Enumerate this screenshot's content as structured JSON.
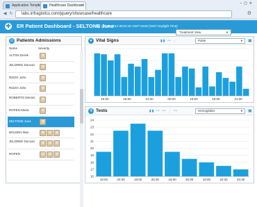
{
  "browser": {
    "tabs": [
      {
        "label": "Application Templat"
      },
      {
        "label": "Healthcare Dashboard"
      }
    ],
    "url": "labs.infragistics.com/jquery/showcase/healthcare"
  },
  "app": {
    "title": "ER Patient Dashboard - SELTONE June",
    "datetime": "Tue Oct 16 2012 08:01:01 GMT+0100 (GMT Daylight Time)",
    "view_dropdown": "Treatment View"
  },
  "patients": {
    "title": "Patients Admissions",
    "col_name": "Name",
    "col_severity": "Severity",
    "rows": [
      {
        "name": "ALTON Derek",
        "severity": 1
      },
      {
        "name": "JELDREE Duncan",
        "severity": 1
      },
      {
        "name": "RIZZO John",
        "severity": 1
      },
      {
        "name": "RIZZO John",
        "severity": 1
      },
      {
        "name": "ROBERTO Dennis",
        "severity": 1
      },
      {
        "name": "ROPEN Maria",
        "severity": 1
      },
      {
        "name": "SELTONE June",
        "severity": 1,
        "selected": true
      },
      {
        "name": "BOLDEN Man",
        "severity": 3
      },
      {
        "name": "JELDREE Duncan",
        "severity": 3
      },
      {
        "name": "ROPEN",
        "severity": 3
      }
    ]
  },
  "vital_signs": {
    "title": "Vital Signs",
    "select": "Pulse",
    "chart_data": {
      "type": "bar",
      "ylabel": "",
      "ylim": [
        0,
        100
      ],
      "xticks": [
        "15:00",
        "18:00",
        "21:00",
        "00:00",
        "15:00",
        "18:00",
        "21:00"
      ],
      "values": [
        90,
        88,
        75,
        88,
        40,
        68,
        62,
        78,
        40,
        55,
        90,
        90,
        40,
        62,
        58,
        18,
        62,
        20,
        50,
        38,
        30,
        62,
        15
      ]
    }
  },
  "tests": {
    "title": "Tests",
    "select": "Hemoglobin",
    "chart_data": {
      "type": "bar",
      "ylim": [
        16,
        24
      ],
      "yticks": [
        "16",
        "17",
        "18",
        "19",
        "20",
        "21",
        "22",
        "23",
        "24"
      ],
      "xticks": [
        "18:00",
        "20:30",
        "18:00",
        "20:30",
        "18:00",
        "20:30",
        "18:00",
        "20:30",
        "20:30"
      ],
      "values": [
        19.5,
        22.5,
        23.5,
        22.5,
        19.5,
        18.5,
        18.0,
        17.5,
        17.0
      ]
    }
  },
  "colors": {
    "accent": "#2a9ad6",
    "bar": "#1ca0dd"
  }
}
